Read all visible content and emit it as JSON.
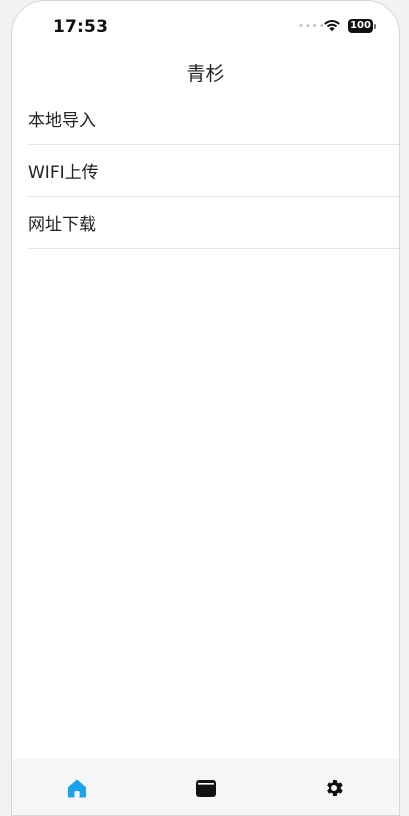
{
  "status_bar": {
    "time": "17:53",
    "signal_dots": "••••",
    "battery_level": "100"
  },
  "nav": {
    "title": "青杉"
  },
  "menu": {
    "items": [
      {
        "label": "本地导入"
      },
      {
        "label": "WIFI上传"
      },
      {
        "label": "网址下载"
      }
    ]
  },
  "tab_bar": {
    "tabs": [
      {
        "icon": "home-icon",
        "active": true
      },
      {
        "icon": "wallet-icon",
        "active": false
      },
      {
        "icon": "gear-icon",
        "active": false
      }
    ],
    "active_color": "#1aa3e8",
    "inactive_color": "#111111"
  }
}
